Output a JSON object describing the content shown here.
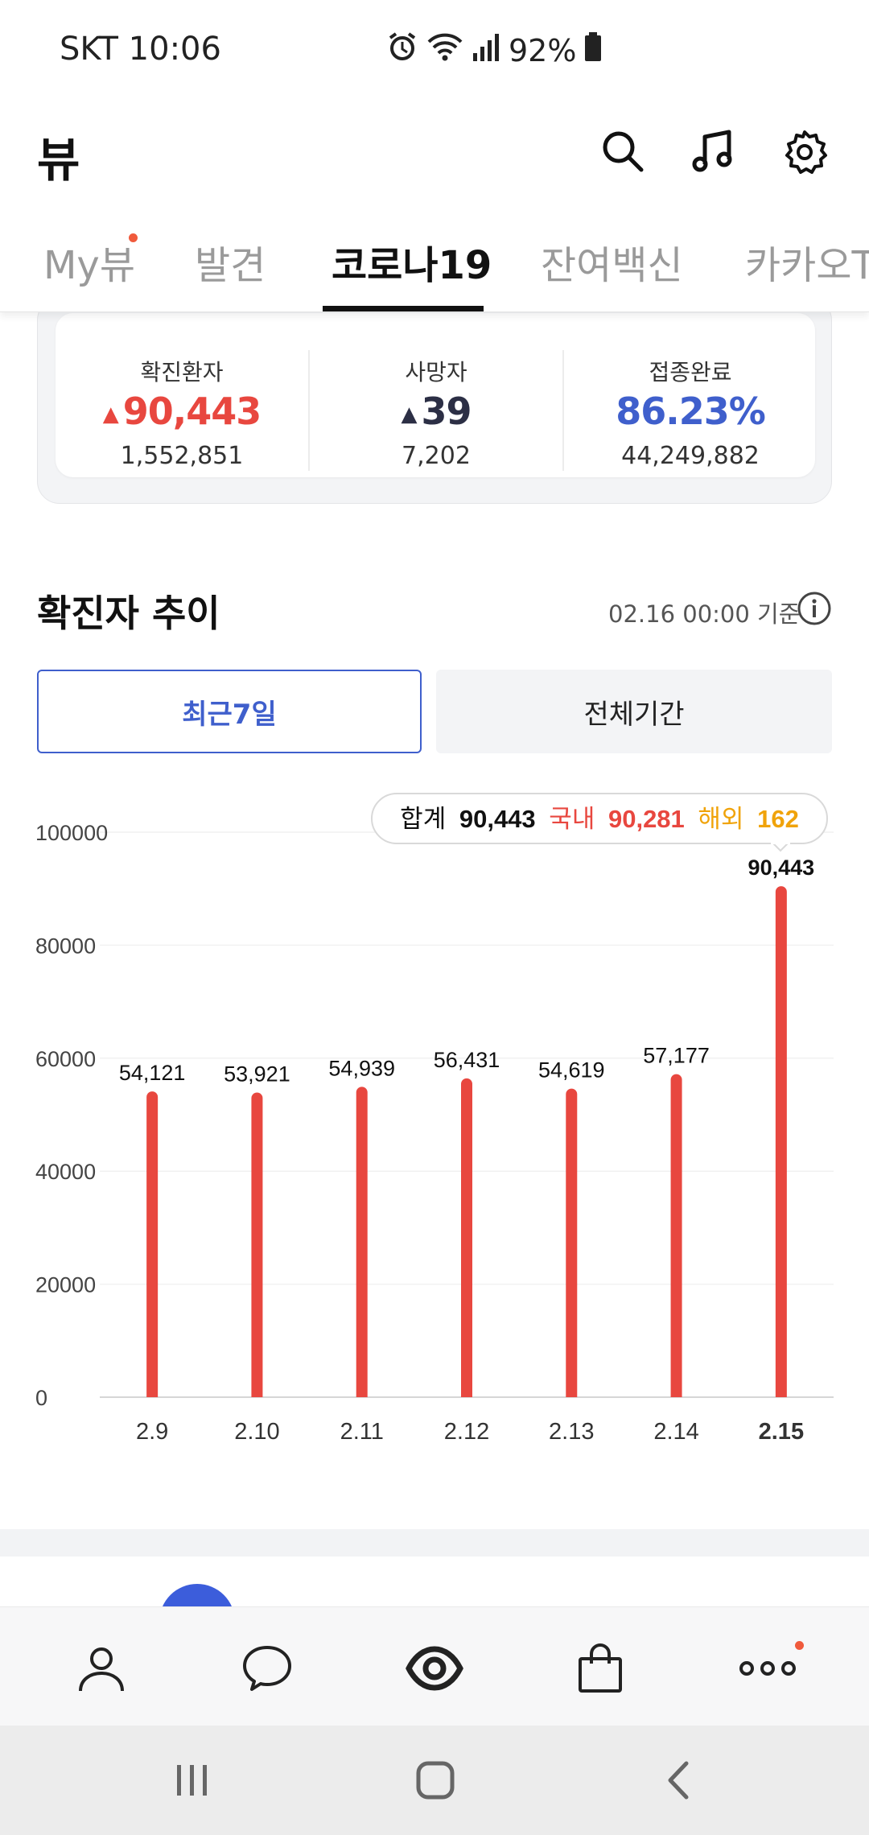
{
  "status_bar": {
    "carrier_time": "SKT 10:06",
    "battery": "92%"
  },
  "header": {
    "title": "뷰"
  },
  "tabs": [
    {
      "label": "My뷰",
      "active": false
    },
    {
      "label": "발견",
      "active": false
    },
    {
      "label": "코로나19",
      "active": true
    },
    {
      "label": "잔여백신",
      "active": false
    },
    {
      "label": "카카오T",
      "active": false
    }
  ],
  "summary": {
    "confirmed": {
      "label": "확진환자",
      "delta": "90,443",
      "total": "1,552,851"
    },
    "deaths": {
      "label": "사망자",
      "delta": "39",
      "total": "7,202"
    },
    "vaccinated": {
      "label": "접종완료",
      "rate": "86.23%",
      "total": "44,249,882"
    }
  },
  "trend": {
    "title": "확진자 추이",
    "basis": "02.16 00:00 기준",
    "btn_recent": "최근7일",
    "btn_all": "전체기간"
  },
  "tooltip": {
    "sum_label": "합계",
    "sum_value": "90,443",
    "domestic_label": "국내",
    "domestic_value": "90,281",
    "overseas_label": "해외",
    "overseas_value": "162"
  },
  "colors": {
    "bar": "#e8473f",
    "accent_blue": "#3f5fcc",
    "overseas": "#f0a30a"
  },
  "chart_data": {
    "type": "bar",
    "categories": [
      "2.9",
      "2.10",
      "2.11",
      "2.12",
      "2.13",
      "2.14",
      "2.15"
    ],
    "values": [
      54121,
      53921,
      54939,
      56431,
      54619,
      57177,
      90443
    ],
    "value_labels": [
      "54,121",
      "53,921",
      "54,939",
      "56,431",
      "54,619",
      "57,177",
      "90,443"
    ],
    "yticks": [
      0,
      20000,
      40000,
      60000,
      80000,
      100000
    ],
    "ylim": [
      0,
      100000
    ],
    "grid": true,
    "highlight_index": 6
  }
}
